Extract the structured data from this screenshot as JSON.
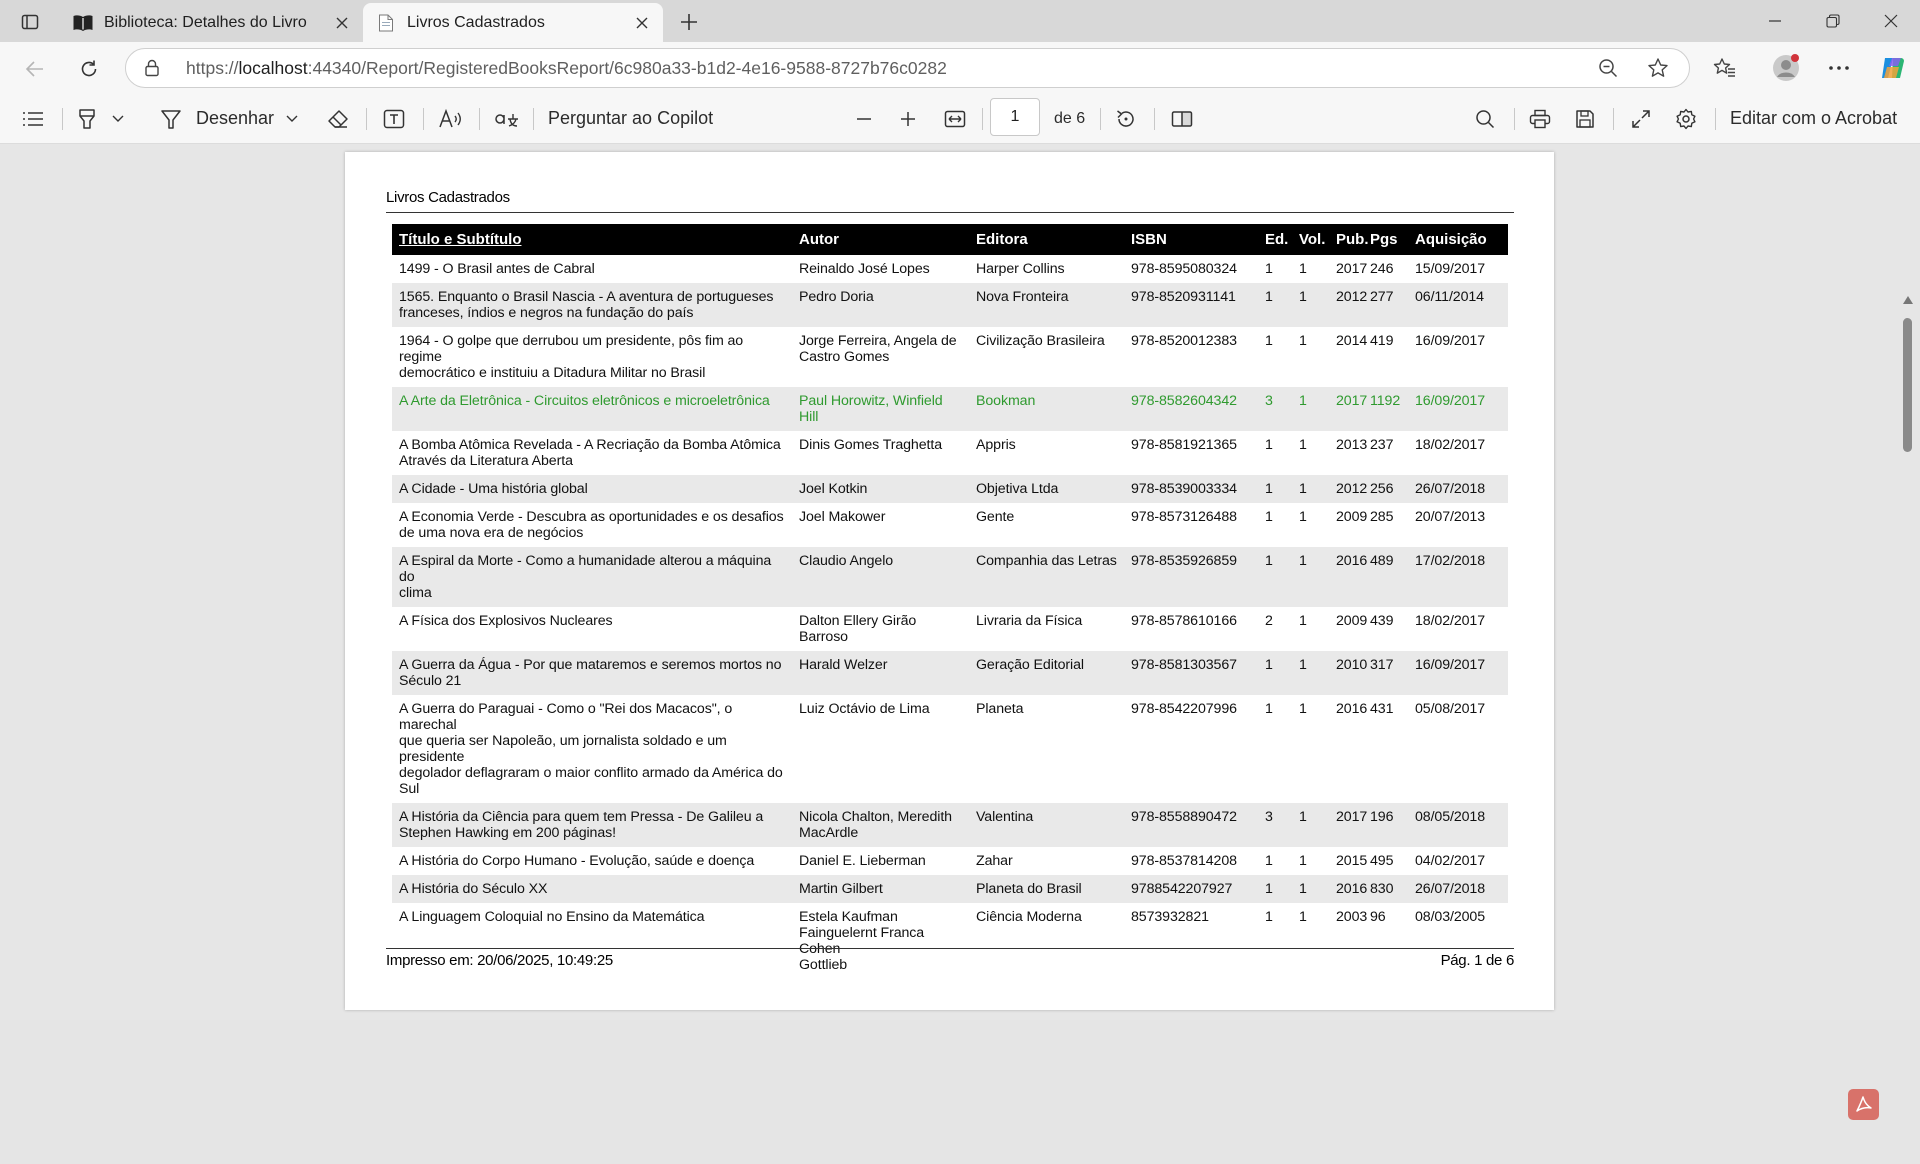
{
  "browser": {
    "tabs": [
      {
        "title": "Biblioteca: Detalhes do Livro",
        "active": false
      },
      {
        "title": "Livros Cadastrados",
        "active": true
      }
    ],
    "url_prefix": "https://",
    "url_host": "localhost",
    "url_rest": ":44340/Report/RegisteredBooksReport/6c980a33-b1d2-4e16-9588-8727b76c0282"
  },
  "pdf_toolbar": {
    "draw_label": "Desenhar",
    "copilot_label": "Perguntar ao Copilot",
    "page_current": "1",
    "page_total": "de 6",
    "edit_acrobat_label": "Editar com o Acrobat"
  },
  "report": {
    "title": "Livros Cadastrados",
    "columns": [
      "Título e Subtítulo",
      "Autor",
      "Editora",
      "ISBN",
      "Ed.",
      "Vol.",
      "Pub.",
      "Pgs",
      "Aquisição"
    ],
    "rows": [
      [
        "1499 - O Brasil antes de Cabral",
        "Reinaldo José Lopes",
        "Harper Collins",
        "978-8595080324",
        "1",
        "1",
        "2017",
        "246",
        "15/09/2017"
      ],
      [
        "1565. Enquanto o Brasil Nascia - A aventura de portugueses\nfranceses, índios e negros na fundação do país",
        "Pedro Doria",
        "Nova Fronteira",
        "978-8520931141",
        "1",
        "1",
        "2012",
        "277",
        "06/11/2014"
      ],
      [
        "1964 - O golpe que derrubou um presidente, pôs fim ao regime\ndemocrático e instituiu a Ditadura Militar no Brasil",
        "Jorge Ferreira, Angela de\nCastro Gomes",
        "Civilização Brasileira",
        "978-8520012383",
        "1",
        "1",
        "2014",
        "419",
        "16/09/2017"
      ],
      [
        "A Arte da Eletrônica - Circuitos eletrônicos e microeletrônica",
        "Paul Horowitz, Winfield Hill",
        "Bookman",
        "978-8582604342",
        "3",
        "1",
        "2017",
        "1192",
        "16/09/2017"
      ],
      [
        "A Bomba Atômica Revelada - A Recriação da Bomba Atômica\nAtravés da Literatura Aberta",
        "Dinis Gomes Traghetta",
        "Appris",
        "978-8581921365",
        "1",
        "1",
        "2013",
        "237",
        "18/02/2017"
      ],
      [
        "A Cidade - Uma história global",
        "Joel Kotkin",
        "Objetiva Ltda",
        "978-8539003334",
        "1",
        "1",
        "2012",
        "256",
        "26/07/2018"
      ],
      [
        "A Economia Verde - Descubra as oportunidades e os desafios\nde uma nova era de negócios",
        "Joel Makower",
        "Gente",
        "978-8573126488",
        "1",
        "1",
        "2009",
        "285",
        "20/07/2013"
      ],
      [
        "A Espiral da Morte - Como a humanidade alterou a máquina do\nclima",
        "Claudio Angelo",
        "Companhia das Letras",
        "978-8535926859",
        "1",
        "1",
        "2016",
        "489",
        "17/02/2018"
      ],
      [
        "A Física dos Explosivos Nucleares",
        "Dalton Ellery Girão Barroso",
        "Livraria da Física",
        "978-8578610166",
        "2",
        "1",
        "2009",
        "439",
        "18/02/2017"
      ],
      [
        "A Guerra da Água - Por que mataremos e seremos mortos no\nSéculo 21",
        "Harald Welzer",
        "Geração Editorial",
        "978-8581303567",
        "1",
        "1",
        "2010",
        "317",
        "16/09/2017"
      ],
      [
        "A Guerra do Paraguai - Como o \"Rei dos Macacos\", o marechal\nque queria ser Napoleão, um jornalista soldado e um presidente\ndegolador deflagraram o maior conflito armado da América do\nSul",
        "Luiz Octávio de Lima",
        "Planeta",
        "978-8542207996",
        "1",
        "1",
        "2016",
        "431",
        "05/08/2017"
      ],
      [
        "A História da Ciência para quem tem Pressa - De Galileu a\nStephen Hawking em 200 páginas!",
        "Nicola Chalton, Meredith\nMacArdle",
        "Valentina",
        "978-8558890472",
        "3",
        "1",
        "2017",
        "196",
        "08/05/2018"
      ],
      [
        "A História do Corpo Humano - Evolução, saúde e doença",
        "Daniel E. Lieberman",
        "Zahar",
        "978-8537814208",
        "1",
        "1",
        "2015",
        "495",
        "04/02/2017"
      ],
      [
        "A História do Século XX",
        "Martin Gilbert",
        "Planeta do Brasil",
        "9788542207927",
        "1",
        "1",
        "2016",
        "830",
        "26/07/2018"
      ],
      [
        "A Linguagem Coloquial no Ensino da Matemática",
        "Estela Kaufman\nFainguelernt Franca Cohen\nGottlieb",
        "Ciência Moderna",
        "8573932821",
        "1",
        "1",
        "2003",
        "96",
        "08/03/2005"
      ]
    ],
    "highlight_row": 3,
    "highlight_color": "#2f9a2f",
    "printed_at": "Impresso em: 20/06/2025, 10:49:25",
    "page_label": "Pág. 1 de 6"
  }
}
